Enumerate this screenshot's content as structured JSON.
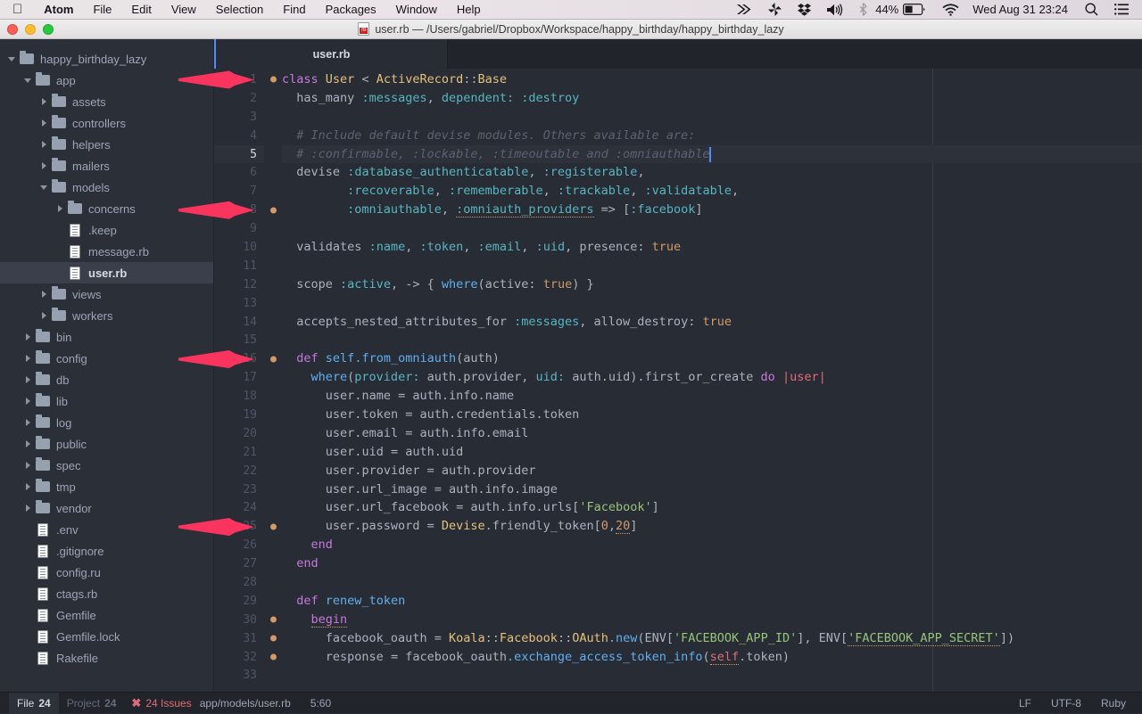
{
  "menubar": {
    "apple_icon": "apple-logo-icon",
    "items": [
      "Atom",
      "File",
      "Edit",
      "View",
      "Selection",
      "Find",
      "Packages",
      "Window",
      "Help"
    ],
    "status_icons": [
      "fast-forward-icon",
      "pinwheel-icon",
      "dropbox-icon",
      "volume-icon",
      "bluetooth-icon"
    ],
    "battery_percent": "44%",
    "clock": "Wed Aug 31  23:24",
    "search_icon": "search-icon",
    "list_icon": "notification-center-icon"
  },
  "titlebar": {
    "file_icon": "ruby-file-icon",
    "title": "user.rb — /Users/gabriel/Dropbox/Workspace/happy_birthday/happy_birthday_lazy"
  },
  "tree": {
    "items": [
      {
        "label": "happy_birthday_lazy",
        "type": "folder",
        "state": "open",
        "depth": 0,
        "selected": false
      },
      {
        "label": "app",
        "type": "folder",
        "state": "open",
        "depth": 1,
        "selected": false
      },
      {
        "label": "assets",
        "type": "folder",
        "state": "closed",
        "depth": 2,
        "selected": false
      },
      {
        "label": "controllers",
        "type": "folder",
        "state": "closed",
        "depth": 2,
        "selected": false
      },
      {
        "label": "helpers",
        "type": "folder",
        "state": "closed",
        "depth": 2,
        "selected": false
      },
      {
        "label": "mailers",
        "type": "folder",
        "state": "closed",
        "depth": 2,
        "selected": false
      },
      {
        "label": "models",
        "type": "folder",
        "state": "open",
        "depth": 2,
        "selected": false
      },
      {
        "label": "concerns",
        "type": "folder",
        "state": "closed",
        "depth": 3,
        "selected": false
      },
      {
        "label": ".keep",
        "type": "file",
        "state": "",
        "depth": 3,
        "selected": false
      },
      {
        "label": "message.rb",
        "type": "file",
        "state": "",
        "depth": 3,
        "selected": false
      },
      {
        "label": "user.rb",
        "type": "file",
        "state": "",
        "depth": 3,
        "selected": true
      },
      {
        "label": "views",
        "type": "folder",
        "state": "closed",
        "depth": 2,
        "selected": false
      },
      {
        "label": "workers",
        "type": "folder",
        "state": "closed",
        "depth": 2,
        "selected": false
      },
      {
        "label": "bin",
        "type": "folder",
        "state": "closed",
        "depth": 1,
        "selected": false
      },
      {
        "label": "config",
        "type": "folder",
        "state": "closed",
        "depth": 1,
        "selected": false
      },
      {
        "label": "db",
        "type": "folder",
        "state": "closed",
        "depth": 1,
        "selected": false
      },
      {
        "label": "lib",
        "type": "folder",
        "state": "closed",
        "depth": 1,
        "selected": false
      },
      {
        "label": "log",
        "type": "folder",
        "state": "closed",
        "depth": 1,
        "selected": false
      },
      {
        "label": "public",
        "type": "folder",
        "state": "closed",
        "depth": 1,
        "selected": false
      },
      {
        "label": "spec",
        "type": "folder",
        "state": "closed",
        "depth": 1,
        "selected": false
      },
      {
        "label": "tmp",
        "type": "folder",
        "state": "closed",
        "depth": 1,
        "selected": false
      },
      {
        "label": "vendor",
        "type": "folder",
        "state": "closed",
        "depth": 1,
        "selected": false
      },
      {
        "label": ".env",
        "type": "file",
        "state": "",
        "depth": 1,
        "selected": false
      },
      {
        "label": ".gitignore",
        "type": "file",
        "state": "",
        "depth": 1,
        "selected": false
      },
      {
        "label": "config.ru",
        "type": "file",
        "state": "",
        "depth": 1,
        "selected": false
      },
      {
        "label": "ctags.rb",
        "type": "file",
        "state": "",
        "depth": 1,
        "selected": false
      },
      {
        "label": "Gemfile",
        "type": "file",
        "state": "",
        "depth": 1,
        "selected": false
      },
      {
        "label": "Gemfile.lock",
        "type": "file",
        "state": "",
        "depth": 1,
        "selected": false
      },
      {
        "label": "Rakefile",
        "type": "file",
        "state": "",
        "depth": 1,
        "selected": false
      }
    ]
  },
  "tabbar": {
    "tabs": [
      {
        "label": "user.rb",
        "active": true
      }
    ]
  },
  "editor": {
    "active_line": 5,
    "cursor_position": "5:60",
    "marker_lines": [
      1,
      8,
      16,
      25,
      30,
      31,
      32
    ],
    "annotation_arrow_lines": [
      1,
      8,
      16,
      25
    ],
    "annotation_arrow_color": "#f9355f",
    "lines": [
      {
        "n": 1,
        "text": "class User < ActiveRecord::Base"
      },
      {
        "n": 2,
        "text": "  has_many :messages, dependent: :destroy"
      },
      {
        "n": 3,
        "text": ""
      },
      {
        "n": 4,
        "text": "  # Include default devise modules. Others available are:"
      },
      {
        "n": 5,
        "text": "  # :confirmable, :lockable, :timeoutable and :omniauthable"
      },
      {
        "n": 6,
        "text": "  devise :database_authenticatable, :registerable,"
      },
      {
        "n": 7,
        "text": "         :recoverable, :rememberable, :trackable, :validatable,"
      },
      {
        "n": 8,
        "text": "         :omniauthable, :omniauth_providers => [:facebook]"
      },
      {
        "n": 9,
        "text": ""
      },
      {
        "n": 10,
        "text": "  validates :name, :token, :email, :uid, presence: true"
      },
      {
        "n": 11,
        "text": ""
      },
      {
        "n": 12,
        "text": "  scope :active, -> { where(active: true) }"
      },
      {
        "n": 13,
        "text": ""
      },
      {
        "n": 14,
        "text": "  accepts_nested_attributes_for :messages, allow_destroy: true"
      },
      {
        "n": 15,
        "text": ""
      },
      {
        "n": 16,
        "text": "  def self.from_omniauth(auth)"
      },
      {
        "n": 17,
        "text": "    where(provider: auth.provider, uid: auth.uid).first_or_create do |user|"
      },
      {
        "n": 18,
        "text": "      user.name = auth.info.name"
      },
      {
        "n": 19,
        "text": "      user.token = auth.credentials.token"
      },
      {
        "n": 20,
        "text": "      user.email = auth.info.email"
      },
      {
        "n": 21,
        "text": "      user.uid = auth.uid"
      },
      {
        "n": 22,
        "text": "      user.provider = auth.provider"
      },
      {
        "n": 23,
        "text": "      user.url_image = auth.info.image"
      },
      {
        "n": 24,
        "text": "      user.url_facebook = auth.info.urls['Facebook']"
      },
      {
        "n": 25,
        "text": "      user.password = Devise.friendly_token[0,20]"
      },
      {
        "n": 26,
        "text": "    end"
      },
      {
        "n": 27,
        "text": "  end"
      },
      {
        "n": 28,
        "text": ""
      },
      {
        "n": 29,
        "text": "  def renew_token"
      },
      {
        "n": 30,
        "text": "    begin"
      },
      {
        "n": 31,
        "text": "      facebook_oauth = Koala::Facebook::OAuth.new(ENV['FACEBOOK_APP_ID'], ENV['FACEBOOK_APP_SECRET'])"
      },
      {
        "n": 32,
        "text": "      response = facebook_oauth.exchange_access_token_info(self.token)"
      },
      {
        "n": 33,
        "text": ""
      }
    ]
  },
  "statusbar": {
    "file_tab": {
      "label": "File",
      "count": "24"
    },
    "project_tab": {
      "label": "Project",
      "count": "24"
    },
    "issues": {
      "icon": "error-x-icon",
      "label": "24 Issues"
    },
    "path": "app/models/user.rb",
    "cursor": "5:60",
    "line_ending": "LF",
    "encoding": "UTF-8",
    "grammar": "Ruby"
  }
}
